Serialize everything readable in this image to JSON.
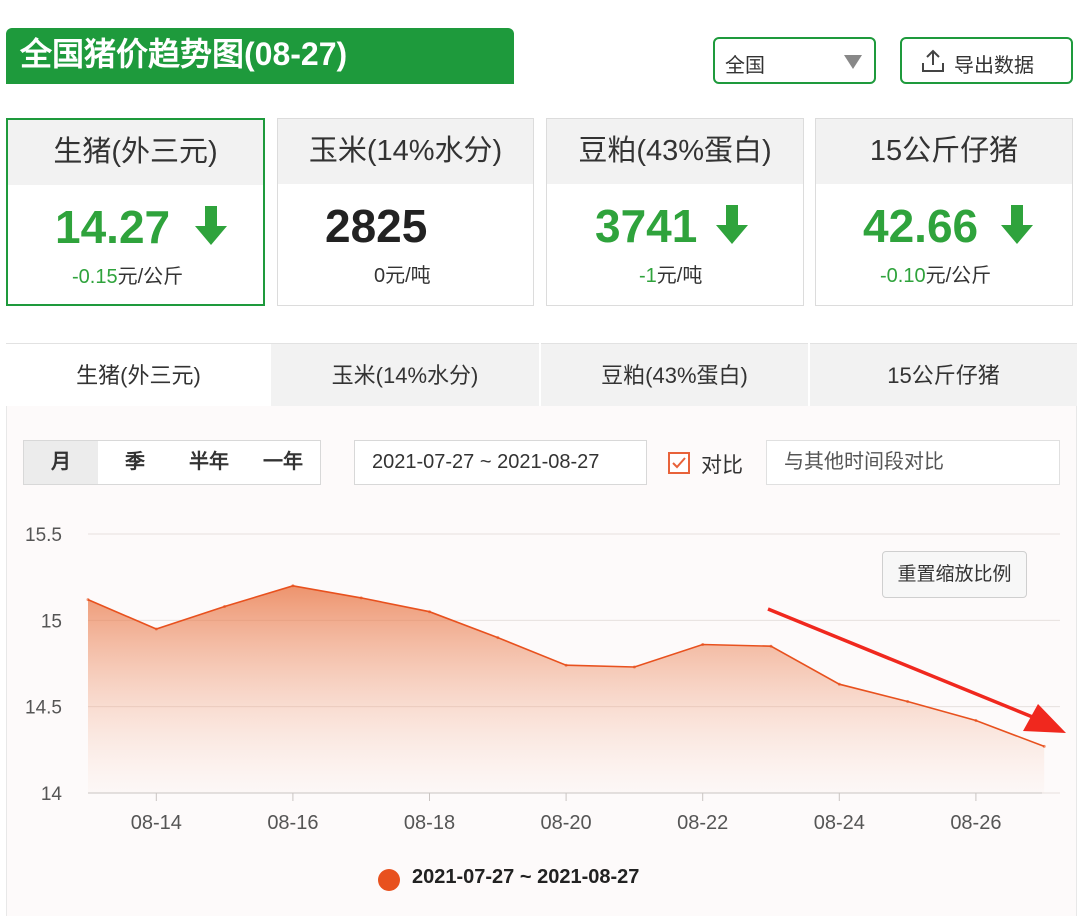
{
  "header": {
    "title": "全国猪价趋势图(08-27)",
    "region_value": "全国",
    "export_label": "导出数据"
  },
  "cards": [
    {
      "name": "生猪(外三元)",
      "value": "14.27",
      "change": "-0.15",
      "unit": "元/公斤",
      "trend": "down",
      "color": "#2fa33c"
    },
    {
      "name": "玉米(14%水分)",
      "value": "2825",
      "change": "0",
      "unit": "元/吨",
      "trend": "flat",
      "color": "#222222"
    },
    {
      "name": "豆粕(43%蛋白)",
      "value": "3741",
      "change": "-1",
      "unit": "元/吨",
      "trend": "down",
      "color": "#2fa33c"
    },
    {
      "name": "15公斤仔猪",
      "value": "42.66",
      "change": "-0.10",
      "unit": "元/公斤",
      "trend": "down",
      "color": "#2fa33c"
    }
  ],
  "tabs": [
    {
      "label": "生猪(外三元)",
      "active": true
    },
    {
      "label": "玉米(14%水分)",
      "active": false
    },
    {
      "label": "豆粕(43%蛋白)",
      "active": false
    },
    {
      "label": "15公斤仔猪",
      "active": false
    }
  ],
  "controls": {
    "periods": [
      "月",
      "季",
      "半年",
      "一年"
    ],
    "active_period": "月",
    "date_range": "2021-07-27 ~ 2021-08-27",
    "compare_label": "对比",
    "compare_checked": true,
    "other_period_placeholder": "与其他时间段对比",
    "reset_zoom_label": "重置缩放比例"
  },
  "chart_data": {
    "type": "area",
    "title": "",
    "xlabel": "",
    "ylabel": "",
    "ylim": [
      14,
      15.5
    ],
    "yticks": [
      "15.5",
      "15",
      "14.5",
      "14"
    ],
    "xticks": [
      "08-14",
      "08-16",
      "08-18",
      "08-20",
      "08-22",
      "08-24",
      "08-26"
    ],
    "x": [
      "08-13",
      "08-14",
      "08-15",
      "08-16",
      "08-17",
      "08-18",
      "08-19",
      "08-20",
      "08-21",
      "08-22",
      "08-23",
      "08-24",
      "08-25",
      "08-26",
      "08-27"
    ],
    "series": [
      {
        "name": "2021-07-27 ~ 2021-08-27",
        "color": "#e8511e",
        "values": [
          15.12,
          14.95,
          15.08,
          15.2,
          15.13,
          15.05,
          14.9,
          14.74,
          14.73,
          14.86,
          14.85,
          14.63,
          14.53,
          14.42,
          14.27
        ]
      }
    ],
    "grid": true,
    "legend": "bottom-center",
    "annotation": "red-arrow-downtrend"
  }
}
